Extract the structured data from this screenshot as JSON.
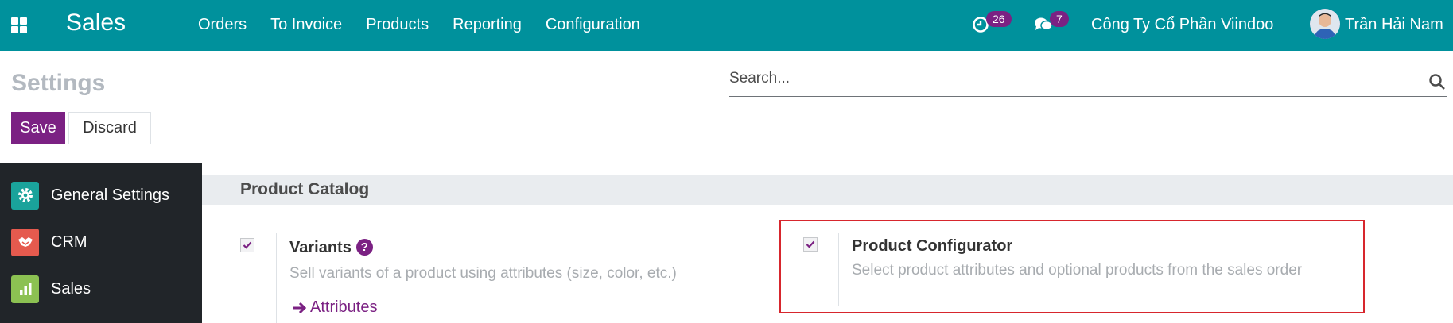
{
  "navbar": {
    "app_name": "Sales",
    "menu": [
      "Orders",
      "To Invoice",
      "Products",
      "Reporting",
      "Configuration"
    ],
    "activity_count": "26",
    "message_count": "7",
    "company": "Công Ty Cổ Phần Viindoo",
    "user": "Trần Hải Nam",
    "color": "#00919c"
  },
  "control_panel": {
    "title": "Settings",
    "search_placeholder": "Search...",
    "save_label": "Save",
    "discard_label": "Discard"
  },
  "sidebar": {
    "items": [
      {
        "label": "General Settings",
        "icon": "gear-icon",
        "color": "#1aa39b"
      },
      {
        "label": "CRM",
        "icon": "handshake-icon",
        "color": "#e55a4e"
      },
      {
        "label": "Sales",
        "icon": "chart-icon",
        "color": "#8cc152"
      }
    ]
  },
  "content": {
    "section_title": "Product Catalog",
    "options": [
      {
        "title": "Variants",
        "description": "Sell variants of a product using attributes (size, color, etc.)",
        "checked": true,
        "link": "Attributes"
      },
      {
        "title": "Product Configurator",
        "description": "Select product attributes and optional products from the sales order",
        "checked": true
      }
    ]
  },
  "accent_color": "#7b2183"
}
